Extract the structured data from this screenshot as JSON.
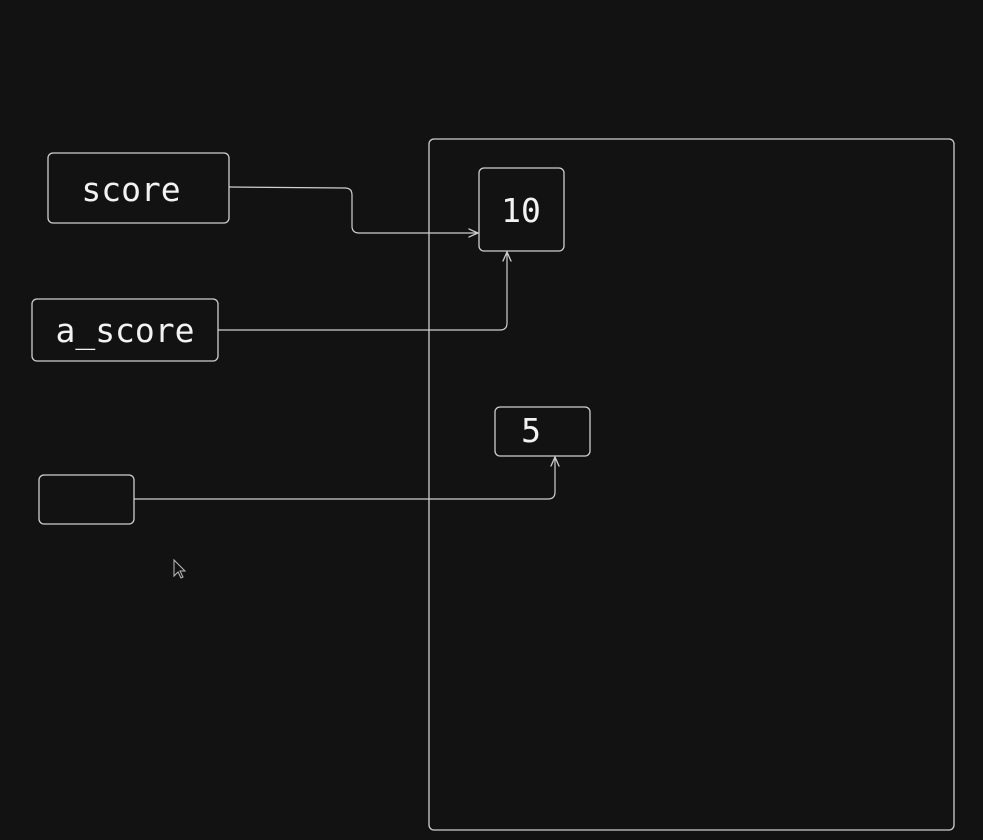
{
  "variables": [
    {
      "id": "score",
      "label": "score"
    },
    {
      "id": "a_score",
      "label": "a_score"
    },
    {
      "id": "unnamed",
      "label": ""
    }
  ],
  "values": [
    {
      "id": "v10",
      "label": "10"
    },
    {
      "id": "v5",
      "label": "5"
    }
  ],
  "references": [
    {
      "from": "score",
      "to": "v10"
    },
    {
      "from": "a_score",
      "to": "v10"
    },
    {
      "from": "unnamed",
      "to": "v5"
    }
  ],
  "colors": {
    "background": "#121212",
    "stroke": "#cfcfcf",
    "text": "#f2f2f2"
  },
  "cursor_icon": "mouse-pointer-icon"
}
